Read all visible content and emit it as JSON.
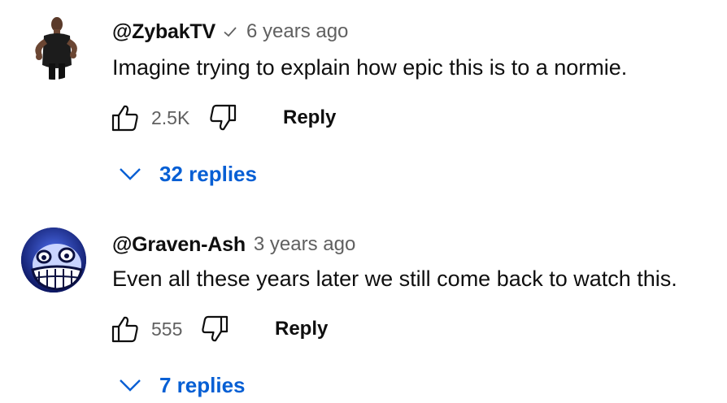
{
  "comments": [
    {
      "author": "@ZybakTV",
      "verified": true,
      "time": "6 years ago",
      "text": "Imagine trying to explain how epic this is to a normie.",
      "likes": "2.5K",
      "reply_label": "Reply",
      "replies_label": "32 replies",
      "avatar_icon": "person-photo"
    },
    {
      "author": "@Graven-Ash",
      "verified": false,
      "time": "3 years ago",
      "text": "Even all these years later we still come back to watch this.",
      "likes": "555",
      "reply_label": "Reply",
      "replies_label": "7 replies",
      "avatar_icon": "cartoon-ghost-face"
    }
  ],
  "colors": {
    "link_blue": "#065fd4",
    "secondary_text": "#606060",
    "primary_text": "#0f0f0f"
  }
}
